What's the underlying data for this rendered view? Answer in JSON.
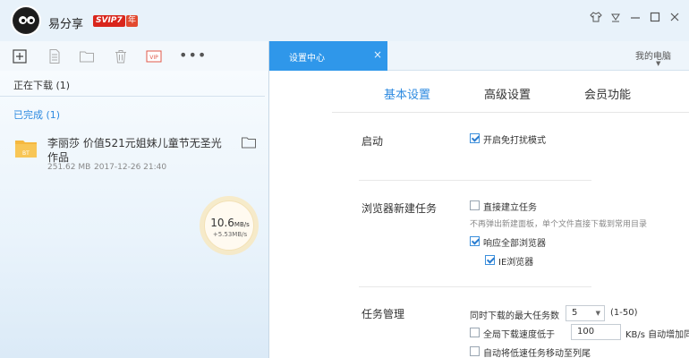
{
  "app": {
    "username": "易分享",
    "vip_badge": "SVIP7",
    "year_badge": "年",
    "window_buttons": [
      "shirt-icon",
      "dropdown-icon",
      "minimize-icon",
      "maximize-icon",
      "close-icon"
    ]
  },
  "toolbar": {
    "icons": [
      "new-task-icon",
      "document-icon",
      "folder-icon",
      "delete-icon",
      "vip-icon"
    ],
    "vip_label": "VIP",
    "more_label": "•••"
  },
  "left": {
    "downloading_label": "正在下载 (1)",
    "completed_label": "已完成 (1)",
    "file": {
      "name": "李丽莎 价值521元姐妹儿童节无圣光作品",
      "type_badge": "BT",
      "size": "251.62 MB",
      "date": "2017-12-26 21:40"
    },
    "speed": {
      "value": "10.6",
      "unit": "MB/s",
      "sub": "+5.53MB/s"
    }
  },
  "tabs": {
    "active_label": "设置中心",
    "close_glyph": "×",
    "right_label": "我的电脑"
  },
  "settings": {
    "tabs": [
      "基本设置",
      "高级设置",
      "会员功能"
    ],
    "startup": {
      "label": "启动",
      "options": [
        {
          "label": "开启免打扰模式",
          "checked": true
        }
      ]
    },
    "browser": {
      "label": "浏览器新建任务",
      "direct": {
        "label": "直接建立任务",
        "checked": false
      },
      "direct_hint": "不再弹出新建面板，单个文件直接下载到常用目录",
      "respond_all": {
        "label": "响应全部浏览器",
        "checked": true
      },
      "ie": {
        "label": "IE浏览器",
        "checked": true
      }
    },
    "task": {
      "label": "任务管理",
      "max_tasks_label": "同时下载的最大任务数",
      "max_tasks_value": "5",
      "max_tasks_range": "(1-50)",
      "global_speed_label": "全局下载速度低于",
      "global_speed_value": "100",
      "global_speed_suffix": "KB/s 自动增加同时下",
      "global_speed_checked": false,
      "move_slow_label": "自动将低速任务移动至列尾",
      "move_slow_checked": false
    }
  }
}
